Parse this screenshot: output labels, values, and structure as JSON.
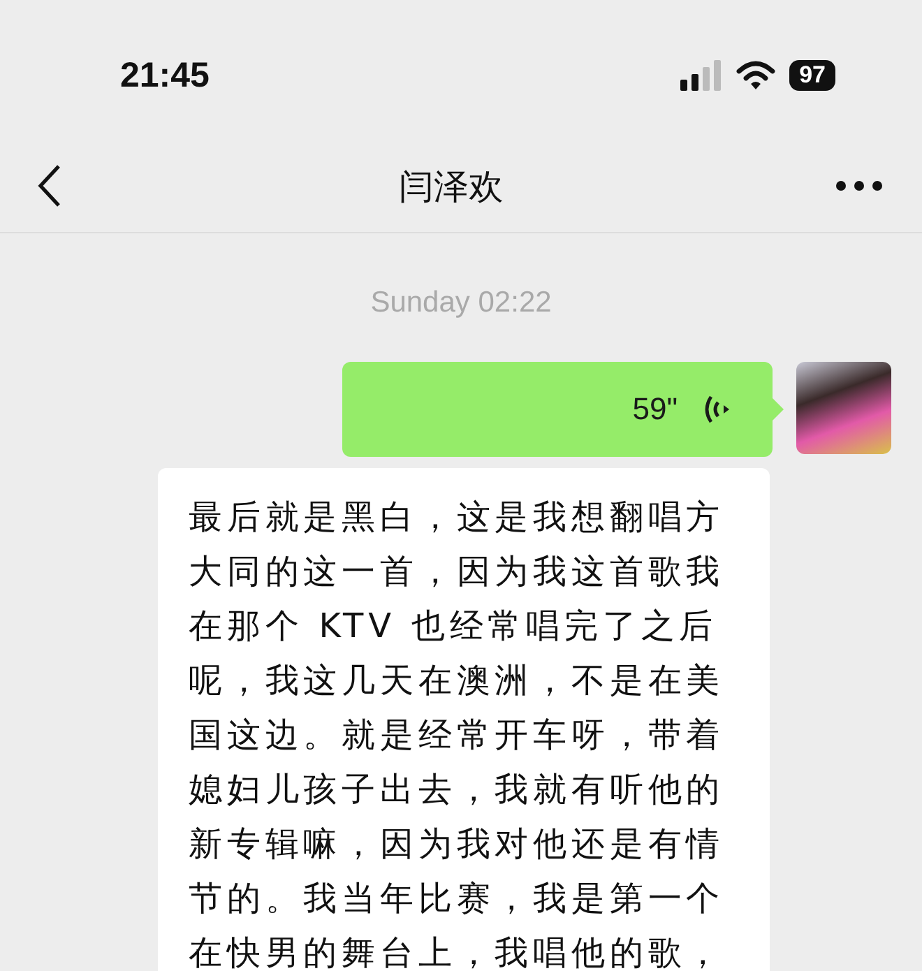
{
  "status_bar": {
    "time": "21:45",
    "battery": "97"
  },
  "nav_bar": {
    "title": "闫泽欢"
  },
  "messages": [
    {
      "kind": "timestamp",
      "text": "Sunday 02:22"
    },
    {
      "kind": "voice",
      "duration": "59\""
    },
    {
      "kind": "text",
      "text": "最后就是黑白，这是我想翻唱方大同的这一首，因为我这首歌我在那个 KTV 也经常唱完了之后呢，我这几天在澳洲，不是在美国这边。就是经常开车呀，带着媳妇儿孩子出去，我就有听他的新专辑嘛，因为我对他还是有情节的。我当年比赛，我是第一个在快男的舞台上，我唱他的歌，"
    }
  ]
}
